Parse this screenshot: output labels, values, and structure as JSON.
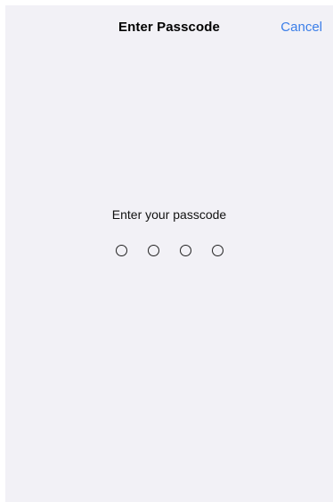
{
  "nav": {
    "title": "Enter Passcode",
    "cancel_label": "Cancel"
  },
  "passcode": {
    "prompt": "Enter your passcode",
    "length": 4,
    "entered": 0
  },
  "colors": {
    "background": "#f2f1f6",
    "accent": "#3b7ee8",
    "text": "#000000"
  }
}
